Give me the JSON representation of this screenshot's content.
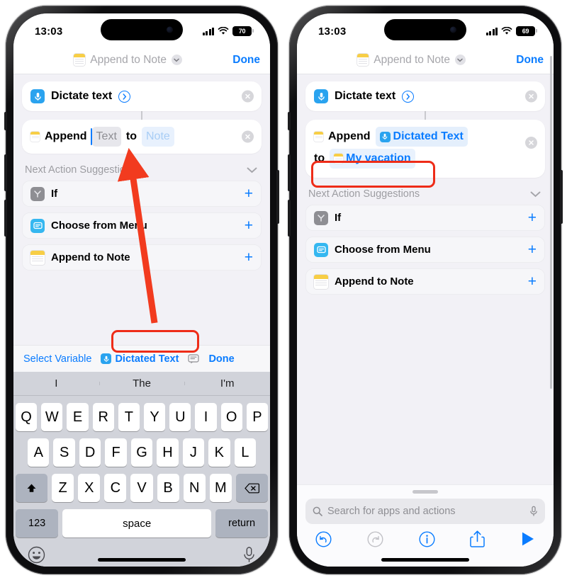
{
  "phones": {
    "left": {
      "status": {
        "clock": "13:03",
        "battery": "70",
        "wifi_icon": "wifi-icon",
        "cell_icon": "cellular-bars-icon"
      },
      "nav": {
        "title": "Append to Note",
        "done_label": "Done",
        "app_icon": "notes-app-icon",
        "chevron_icon": "chevron-down-icon"
      },
      "actions": [
        {
          "label": "Dictate text",
          "icon": "microphone-icon",
          "has_chevron": true,
          "chevron_icon": "chevron-right-circle-icon",
          "clear_icon": "clear-circle-icon"
        }
      ],
      "append": {
        "keyword_1": "Append",
        "field_text": "Text",
        "keyword_2": "to",
        "field_note": "Note",
        "note_icon": "notes-app-icon",
        "clear_icon": "clear-circle-icon"
      },
      "suggestions": {
        "header": "Next Action Suggestions",
        "collapse_icon": "chevron-down-icon",
        "items": [
          {
            "label": "If",
            "icon": "if-condition-icon",
            "add_icon": "plus-icon"
          },
          {
            "label": "Choose from Menu",
            "icon": "choose-from-menu-icon",
            "add_icon": "plus-icon"
          },
          {
            "label": "Append to Note",
            "icon": "notes-app-icon",
            "add_icon": "plus-icon"
          }
        ]
      },
      "variable_bar": {
        "select_variable": "Select Variable",
        "variable_chip": "Dictated Text",
        "variable_chip_icon": "microphone-icon",
        "comment_icon": "comment-bubble-icon",
        "done_label": "Done"
      },
      "keyboard": {
        "predictions": [
          "I",
          "The",
          "I'm"
        ],
        "row1": [
          "Q",
          "W",
          "E",
          "R",
          "T",
          "Y",
          "U",
          "I",
          "O",
          "P"
        ],
        "row2": [
          "A",
          "S",
          "D",
          "F",
          "G",
          "H",
          "J",
          "K",
          "L"
        ],
        "row3": [
          "Z",
          "X",
          "C",
          "V",
          "B",
          "N",
          "M"
        ],
        "shift_icon": "shift-up-icon",
        "backspace_icon": "backspace-icon",
        "numbers_key": "123",
        "space_key": "space",
        "return_key": "return",
        "emoji_icon": "emoji-smiley-icon",
        "dictation_icon": "microphone-icon"
      }
    },
    "right": {
      "status": {
        "clock": "13:03",
        "battery": "69",
        "wifi_icon": "wifi-icon",
        "cell_icon": "cellular-bars-icon"
      },
      "nav": {
        "title": "Append to Note",
        "done_label": "Done",
        "app_icon": "notes-app-icon",
        "chevron_icon": "chevron-down-icon"
      },
      "actions": [
        {
          "label": "Dictate text",
          "icon": "microphone-icon",
          "has_chevron": true,
          "chevron_icon": "chevron-right-circle-icon",
          "clear_icon": "clear-circle-icon"
        }
      ],
      "append": {
        "keyword_1": "Append",
        "variable_text": "Dictated Text",
        "variable_icon": "microphone-icon",
        "keyword_2": "to",
        "note_value": "My vacation",
        "note_icon": "notes-app-icon",
        "clear_icon": "clear-circle-icon"
      },
      "suggestions": {
        "header": "Next Action Suggestions",
        "collapse_icon": "chevron-down-icon",
        "items": [
          {
            "label": "If",
            "icon": "if-condition-icon",
            "add_icon": "plus-icon"
          },
          {
            "label": "Choose from Menu",
            "icon": "choose-from-menu-icon",
            "add_icon": "plus-icon"
          },
          {
            "label": "Append to Note",
            "icon": "notes-app-icon",
            "add_icon": "plus-icon"
          }
        ]
      },
      "bottom": {
        "grabber": "sheet-grabber",
        "search_placeholder": "Search for apps and actions",
        "search_icon": "search-icon",
        "search_mic_icon": "microphone-icon",
        "toolbar": [
          {
            "name": "undo-button",
            "icon": "undo-arrow-icon",
            "enabled": true
          },
          {
            "name": "redo-button",
            "icon": "redo-arrow-icon",
            "enabled": false
          },
          {
            "name": "info-button",
            "icon": "info-circle-icon",
            "enabled": true
          },
          {
            "name": "share-button",
            "icon": "share-arrow-up-icon",
            "enabled": true
          },
          {
            "name": "run-button",
            "icon": "play-triangle-icon",
            "enabled": true
          }
        ]
      }
    }
  },
  "annotations": {
    "arrow": {
      "color": "#f23b1f",
      "from": "dictated-text-chip",
      "to": "text-field"
    },
    "highlight_boxes": [
      {
        "color": "#ee2c18",
        "target": "dictated-text-chip"
      },
      {
        "color": "#ee2c18",
        "target": "my-vacation-note-field"
      }
    ]
  },
  "colors": {
    "accent_blue": "#0a7cff",
    "annotation_red": "#ee2c18",
    "notes_yellow": "#f7ce46",
    "mic_blue": "#2aa3ef",
    "screen_bg": "#f2f1f6",
    "keyboard_bg": "#d1d3da"
  }
}
